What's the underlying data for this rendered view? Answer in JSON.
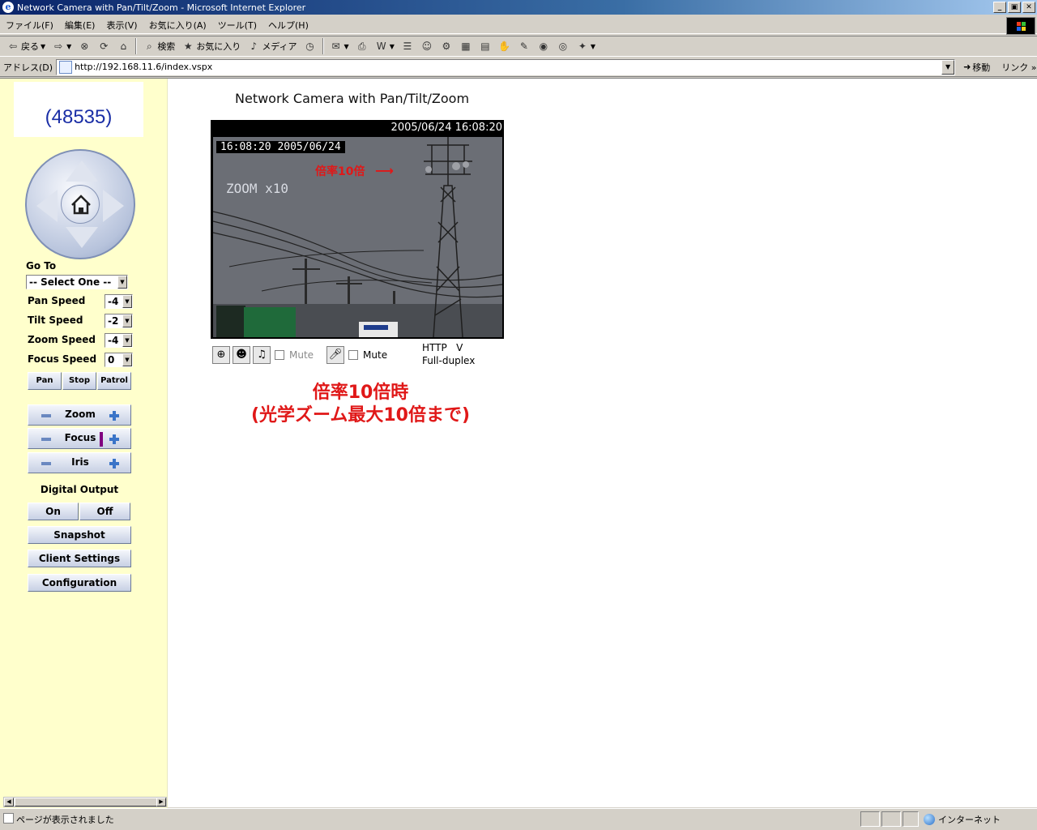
{
  "window": {
    "title": "Network Camera with Pan/Tilt/Zoom - Microsoft Internet Explorer",
    "buttons": {
      "minimize": "_",
      "maximize": "▣",
      "close": "✕"
    }
  },
  "menu": [
    "ファイル(F)",
    "編集(E)",
    "表示(V)",
    "お気に入り(A)",
    "ツール(T)",
    "ヘルプ(H)"
  ],
  "toolbar": {
    "back": "戻る",
    "search": "検索",
    "favorites": "お気に入り",
    "media": "メディア"
  },
  "address": {
    "label": "アドレス(D)",
    "url": "http://192.168.11.6/index.vspx",
    "go": "移動",
    "links": "リンク"
  },
  "sidebar": {
    "camera_id": "(48535)",
    "goto_label": "Go To",
    "goto_value": "-- Select One --",
    "speeds": [
      {
        "label": "Pan Speed",
        "value": "-4"
      },
      {
        "label": "Tilt Speed",
        "value": "-2"
      },
      {
        "label": "Zoom Speed",
        "value": "-4"
      },
      {
        "label": "Focus Speed",
        "value": "0"
      }
    ],
    "pan_buttons": {
      "pan": "Pan",
      "stop": "Stop",
      "patrol": "Patrol"
    },
    "zoom_label": "Zoom",
    "focus_label": "Focus",
    "iris_label": "Iris",
    "digital_output_label": "Digital Output",
    "on_label": "On",
    "off_label": "Off",
    "snapshot_label": "Snapshot",
    "client_settings_label": "Client Settings",
    "configuration_label": "Configuration"
  },
  "main": {
    "title": "Network Camera with Pan/Tilt/Zoom",
    "timestamp": "2005/06/24 16:08:20",
    "osd_time": "16:08:20 2005/06/24",
    "zoom_text": "ZOOM x10",
    "annotation": "倍率10倍",
    "mute_label": "Mute",
    "mute_label_2": "Mute",
    "protocol": "HTTP",
    "protocol_mark": "V",
    "duplex": "Full-duplex",
    "caption_line1": "倍率10倍時",
    "caption_line2": "(光学ズーム最大10倍まで)"
  },
  "status": {
    "text": "ページが表示されました",
    "zone": "インターネット"
  }
}
